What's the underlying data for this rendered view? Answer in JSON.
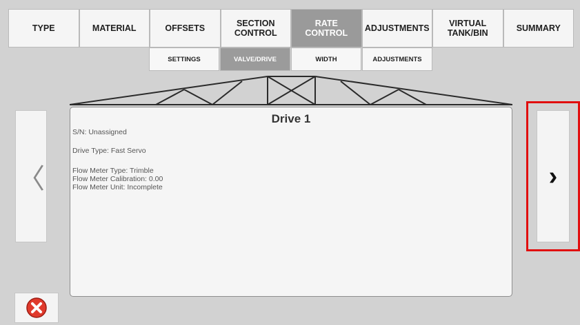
{
  "tabs": [
    {
      "label": "TYPE",
      "active": false
    },
    {
      "label": "MATERIAL",
      "active": false
    },
    {
      "label": "OFFSETS",
      "active": false
    },
    {
      "label": "SECTION\nCONTROL",
      "active": false
    },
    {
      "label": "RATE\nCONTROL",
      "active": true
    },
    {
      "label": "ADJUSTMENTS",
      "active": false
    },
    {
      "label": "VIRTUAL\nTANK/BIN",
      "active": false
    },
    {
      "label": "SUMMARY",
      "active": false
    }
  ],
  "subtabs": [
    {
      "label": "SETTINGS",
      "active": false
    },
    {
      "label": "VALVE/DRIVE",
      "active": true
    },
    {
      "label": "WIDTH",
      "active": false
    },
    {
      "label": "ADJUSTMENTS",
      "active": false
    }
  ],
  "drive": {
    "title": "Drive 1",
    "serial": "S/N: Unassigned",
    "drive_type": "Drive Type: Fast Servo",
    "flow_meter_type": "Flow Meter Type: Trimble",
    "flow_meter_calibration": "Flow Meter Calibration: 0.00",
    "flow_meter_unit": "Flow Meter Unit: Incomplete"
  },
  "nav": {
    "prev_icon": "chevron-left-icon",
    "next_icon": "chevron-right-icon",
    "prev_glyph": "〈",
    "next_glyph": "›"
  },
  "cancel": {
    "icon": "close-circle-icon",
    "color": "#e03a2c"
  },
  "colors": {
    "active_tab": "#9a9a9a",
    "highlight": "#e10e0e"
  }
}
